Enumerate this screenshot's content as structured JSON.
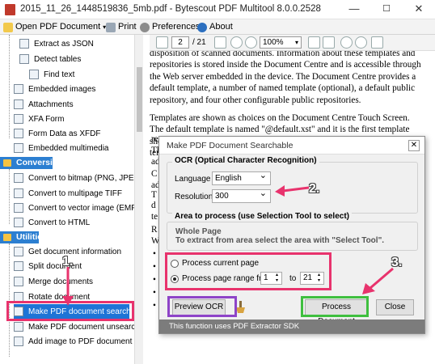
{
  "window": {
    "title": "2015_11_26_1448519836_5mb.pdf - Bytescout PDF Multitool 8.0.0.2528",
    "min": "—",
    "max": "☐",
    "close": "✕"
  },
  "toolbar": {
    "open_label": "Open PDF Document",
    "print_label": "Print",
    "preferences_label": "Preferences",
    "about_label": "About"
  },
  "nav": {
    "page_value": "2",
    "page_total": "/ 21",
    "zoom_value": "100%"
  },
  "sidebar": {
    "top_items": [
      {
        "label": "Extract as JSON"
      },
      {
        "label": "Detect tables"
      },
      {
        "label": "Find text"
      },
      {
        "label": "Embedded images"
      },
      {
        "label": "Attachments"
      },
      {
        "label": "XFA Form"
      },
      {
        "label": "Form Data as XFDF"
      },
      {
        "label": "Embedded multimedia"
      }
    ],
    "group_conversion": "Conversion",
    "conversion_items": [
      {
        "label": "Convert to bitmap (PNG, JPEG, ...)"
      },
      {
        "label": "Convert to multipage TIFF"
      },
      {
        "label": "Convert to vector image (EMF)"
      },
      {
        "label": "Convert to HTML"
      }
    ],
    "group_utilities": "Utilities",
    "utility_items": [
      {
        "label": "Get document information"
      },
      {
        "label": "Split document"
      },
      {
        "label": "Merge documents"
      },
      {
        "label": "Rotate document"
      },
      {
        "label": "Make PDF document searchable"
      },
      {
        "label": "Make PDF document unsearchable"
      },
      {
        "label": "Add image to PDF document"
      }
    ]
  },
  "document": {
    "p1": "disposition of scanned documents. Information about these templates and repositories is stored inside the Document Centre and is accessible through the Web server embedded in the device. The Document Centre provides a default template, a number of named template (optional), a default public repository, and four other configurable public repositories.",
    "p2": "Templates are shown as choices on the Document Centre Touch Screen. The default template is named \"@default.xst\" and it is the first template shown in the template list on the screen. The Xerox Document Centre uses templates and",
    "frag_re": "re",
    "frag_th": "Th",
    "frag_ad": "ad",
    "frag_c1": "C",
    "frag_ad2": "ad",
    "frag_c2": "C",
    "frag_t": "T",
    "frag_d": "d",
    "frag_te": "te",
    "frag_r": "R",
    "frag_w": "W",
    "bullets": [
      "•",
      "•",
      "•",
      "•",
      "•"
    ]
  },
  "dialog": {
    "title": "Make PDF Document Searchable",
    "close": "✕",
    "ocr_legend": "OCR (Optical Character Recognition)",
    "language_label": "Language",
    "language_value": "English",
    "resolution_label": "Resolution",
    "resolution_value": "300",
    "area_legend": "Area to process (use Selection Tool to select)",
    "whole_page": "Whole Page",
    "area_hint": "To extract from area select the area with \"Select Tool\".",
    "process_current": "Process current page",
    "process_range": "Process page range from",
    "range_from": "1",
    "range_to_label": "to",
    "range_to": "21",
    "preview_ocr": "Preview OCR",
    "process_document": "Process Document",
    "close_button": "Close",
    "footer": "This function uses PDF Extractor SDK"
  },
  "annotations": {
    "a1": "1.",
    "a2": "2.",
    "a3": "3."
  },
  "colors": {
    "pink": "#e8336d",
    "purple": "#8e44c8",
    "green": "#3fbf3f",
    "selection": "#1e74d6"
  }
}
